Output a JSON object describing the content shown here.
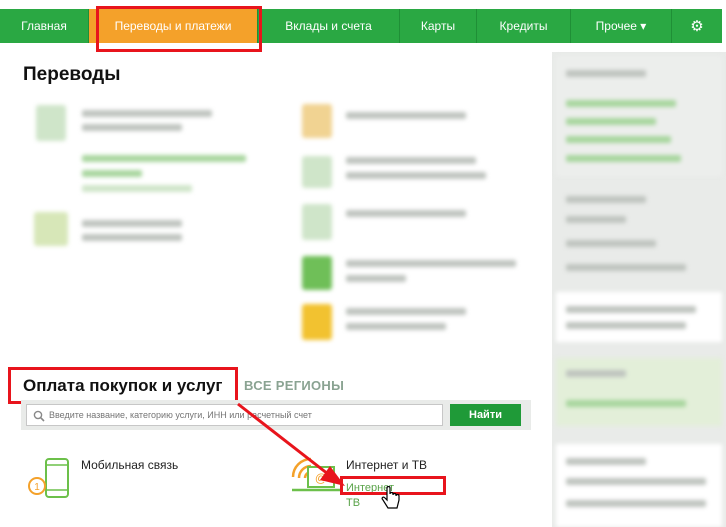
{
  "nav": {
    "items": [
      {
        "label": "Главная"
      },
      {
        "label": "Переводы и платежи"
      },
      {
        "label": "Вклады и счета"
      },
      {
        "label": "Карты"
      },
      {
        "label": "Кредиты"
      },
      {
        "label": "Прочее ▾"
      }
    ],
    "settings_icon": "gear-icon",
    "settings_glyph": "⚙"
  },
  "transfers": {
    "title": "Переводы"
  },
  "payments": {
    "title": "Оплата покупок и услуг",
    "regions_label": "ВСЕ РЕГИОНЫ",
    "search_placeholder": "Введите название, категорию услуги, ИНН или расчетный счет",
    "search_button": "Найти",
    "services": [
      {
        "label": "Мобильная связь",
        "icon": "phone-icon"
      },
      {
        "label": "Интернет и ТВ",
        "icon": "internet-tv-icon",
        "link_1": "Интернет",
        "link_2": "ТВ"
      }
    ]
  },
  "colors": {
    "nav_green": "#2aa843",
    "active_orange": "#f4a12a",
    "button_green": "#1f9a38",
    "highlight_red": "#e8141c",
    "link_green": "#5aa34a"
  }
}
